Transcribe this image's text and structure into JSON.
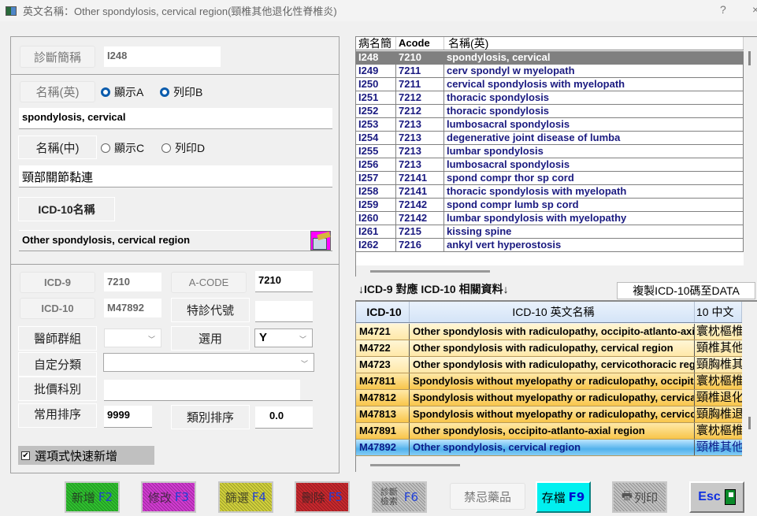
{
  "window": {
    "title": "英文名稱：Other spondylosis, cervical region(頸椎其他退化性脊椎炎)",
    "help_label": "?",
    "close_label": "×"
  },
  "form": {
    "diag_short_label": "診斷簡稱",
    "diag_short_value": "I248",
    "name_en_label": "名稱(英)",
    "radio_show_a": {
      "label": "顯示A",
      "checked": true
    },
    "radio_print_b": {
      "label": "列印B",
      "checked": true
    },
    "name_en_value": "spondylosis, cervical",
    "name_zh_label": "名稱(中)",
    "radio_show_c": {
      "label": "顯示C",
      "checked": false
    },
    "radio_print_d": {
      "label": "列印D",
      "checked": false
    },
    "name_zh_value": "頸部關節黏連",
    "icd10_name_label": "ICD-10名稱",
    "icd10_name_value": "Other spondylosis, cervical region",
    "icd9_label": "ICD-9",
    "icd9_value": "7210",
    "acode_label": "A-CODE",
    "acode_value": "7210",
    "icd10_label": "ICD-10",
    "icd10_value": "M47892",
    "special_code_label": "特診代號",
    "special_code_value": "",
    "doctor_group_label": "醫師群組",
    "doctor_group_value": "",
    "use_label": "選用",
    "use_value": "Y",
    "custom_category_label": "自定分類",
    "custom_category_value": "",
    "price_dept_label": "批價科別",
    "price_dept_value": "",
    "common_sort_label": "常用排序",
    "common_sort_value": "9999",
    "category_sort_label": "類別排序",
    "category_sort_value": "0.0",
    "quick_add_label": "選項式快速新增",
    "quick_add_checked": true
  },
  "diag_grid": {
    "columns": [
      "病名簡",
      "Acode",
      "名稱(英)"
    ],
    "selected_index": 0,
    "rows": [
      [
        "I248",
        "7210",
        "spondylosis, cervical"
      ],
      [
        "I249",
        "7211",
        "cerv spondyl w myelopath"
      ],
      [
        "I250",
        "7211",
        "cervical spondylosis with myelopath"
      ],
      [
        "I251",
        "7212",
        "thoracic spondylosis"
      ],
      [
        "I252",
        "7212",
        "thoracic spondylosis"
      ],
      [
        "I253",
        "7213",
        "lumbosacral spondylosis"
      ],
      [
        "I254",
        "7213",
        "degenerative joint disease of lumba"
      ],
      [
        "I255",
        "7213",
        "lumbar spondylosis"
      ],
      [
        "I256",
        "7213",
        "lumbosacral spondylosis"
      ],
      [
        "I257",
        "72141",
        "spond compr thor sp cord"
      ],
      [
        "I258",
        "72141",
        "thoracic spondylosis with myelopath"
      ],
      [
        "I259",
        "72142",
        "spond compr lumb sp cord"
      ],
      [
        "I260",
        "72142",
        "lumbar spondylosis with myelopathy"
      ],
      [
        "I261",
        "7215",
        "kissing spine"
      ],
      [
        "I262",
        "7216",
        "ankyl vert hyperostosis"
      ]
    ]
  },
  "mapping": {
    "section_label": "↓ICD-9 對應 ICD-10 相關資料↓",
    "copy_button": "複製ICD-10碼至DATA"
  },
  "icd10_grid": {
    "columns": [
      "ICD-10",
      "ICD-10 英文名稱",
      "10 中文"
    ],
    "selected_index": 7,
    "rows": [
      [
        "M4721",
        "Other spondylosis with radiculopathy, occipito-atlanto-axial region",
        "寰枕樞椎"
      ],
      [
        "M4722",
        "Other spondylosis with radiculopathy, cervical region",
        "頸椎其他"
      ],
      [
        "M4723",
        "Other spondylosis with radiculopathy, cervicothoracic region",
        "頸胸椎其"
      ],
      [
        "M47811",
        "Spondylosis without myelopathy or radiculopathy, occipito",
        "寰枕樞椎"
      ],
      [
        "M47812",
        "Spondylosis without myelopathy or radiculopathy, cervical",
        "頸椎退化"
      ],
      [
        "M47813",
        "Spondylosis without myelopathy or radiculopathy, cervicothoracic",
        "頸胸椎退"
      ],
      [
        "M47891",
        "Other spondylosis, occipito-atlanto-axial region",
        "寰枕樞椎"
      ],
      [
        "M47892",
        "Other spondylosis, cervical region",
        "頸椎其他"
      ]
    ]
  },
  "buttons": [
    {
      "name": "add-button",
      "label": "新增",
      "key": "F2",
      "color": "#2fc12f",
      "enabled": false
    },
    {
      "name": "edit-button",
      "label": "修改",
      "key": "F3",
      "color": "#d23bd2",
      "enabled": false
    },
    {
      "name": "filter-button",
      "label": "篩選",
      "key": "F4",
      "color": "#d2d23c",
      "enabled": false
    },
    {
      "name": "delete-button",
      "label": "刪除",
      "key": "F5",
      "color": "#c8282e",
      "enabled": false
    },
    {
      "name": "diag-search-button",
      "label": "診斷檢索",
      "key": "F6",
      "color": "#c4c4c4",
      "enabled": false
    },
    {
      "name": "forbidden-drugs-button",
      "label": "禁忌藥品",
      "key": "",
      "enabled": true
    },
    {
      "name": "save-button",
      "label": "存檔",
      "key": "F9",
      "color": "#00f0f0",
      "enabled": true
    },
    {
      "name": "print-button",
      "label": "列印",
      "key": "",
      "color": "#c4c4c4",
      "enabled": false
    },
    {
      "name": "esc-button",
      "label": "Esc",
      "key": "",
      "color": "#c8c8c8",
      "enabled": true
    }
  ]
}
